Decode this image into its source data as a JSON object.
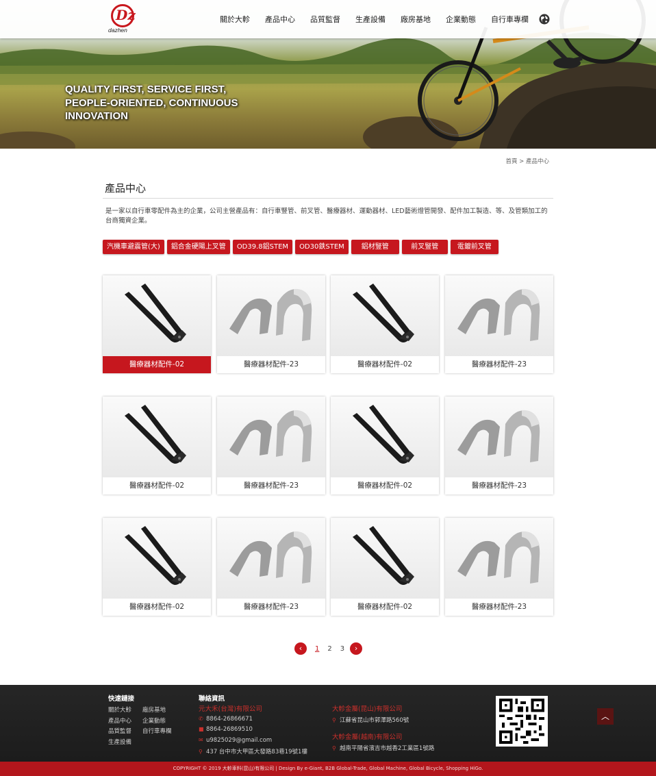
{
  "header": {
    "logo_text": "dazhen",
    "logo_letters": "Dz",
    "nav": [
      "關於大軫",
      "產品中心",
      "品質監督",
      "生產設備",
      "廠房基地",
      "企業動態",
      "自行車專欄"
    ],
    "language_icon": "globe-icon"
  },
  "banner": {
    "slogan_line1": "QUALITY FIRST, SERVICE FIRST,",
    "slogan_line2": "PEOPLE-ORIENTED, CONTINUOUS",
    "slogan_line3": "INNOVATION"
  },
  "breadcrumb": {
    "home": "首頁",
    "sep": ">",
    "current": "產品中心"
  },
  "main": {
    "title": "產品中心",
    "intro": "是一家以自行車零配件為主的企業，公司主營產品有：自行車豎管、前叉管、醫療器材、運動器材、LED藝術燈管開發、配件加工製造、等、及管類加工的台商獨資企業。"
  },
  "categories": [
    "汽機車避震管(大)",
    "鋁合金硬陽上叉管",
    "OD39.8鋁STEM",
    "OD30鉄STEM",
    "鋁材豎管",
    "前叉豎管",
    "電鍍前叉管"
  ],
  "products": [
    {
      "name": "醫療器材配件-02",
      "shape": "fork"
    },
    {
      "name": "醫療器材配件-23",
      "shape": "clamp"
    },
    {
      "name": "醫療器材配件-02",
      "shape": "fork"
    },
    {
      "name": "醫療器材配件-23",
      "shape": "clamp"
    },
    {
      "name": "醫療器材配件-02",
      "shape": "fork"
    },
    {
      "name": "醫療器材配件-23",
      "shape": "clamp"
    },
    {
      "name": "醫療器材配件-02",
      "shape": "fork"
    },
    {
      "name": "醫療器材配件-23",
      "shape": "clamp"
    },
    {
      "name": "醫療器材配件-02",
      "shape": "fork"
    },
    {
      "name": "醫療器材配件-23",
      "shape": "clamp"
    },
    {
      "name": "醫療器材配件-02",
      "shape": "fork"
    },
    {
      "name": "醫療器材配件-23",
      "shape": "clamp"
    }
  ],
  "pager": {
    "prev": "‹",
    "next": "›",
    "pages": [
      "1",
      "2",
      "3"
    ],
    "current": "1"
  },
  "footer": {
    "quick_links_title": "快速鏈接",
    "quick_links": [
      "關於大軫",
      "廠房基地",
      "產品中心",
      "企業動態",
      "品質監督",
      "自行車專欄",
      "生產設備"
    ],
    "contact_title": "聯絡資訊",
    "company1": "元大禾(台灣)有限公司",
    "tel": "8864-26866671",
    "fax": "8864-26869510",
    "email": "u9825029@gmail.com",
    "address1": "437 台中市大甲區大發路83巷19號1樓",
    "company2": "大軫金屬(昆山)有限公司",
    "address2": "江蘇省昆山市郭澤路560號",
    "company3": "大軫金屬(越南)有限公司",
    "address3": "越南平陽省濱吉市越香2工業區1號路",
    "back_to_top": "︿",
    "copyright": "COPYRIGHT © 2019 大軫車料(昆山)有限公司 | Design By e-Giant, B2B Global-Trade, Global Machine, Global Bicycle, Shopping HiGo."
  },
  "colors": {
    "accent": "#c6171e",
    "footer_bg": "#222222",
    "footer_accent": "#c9302c"
  }
}
